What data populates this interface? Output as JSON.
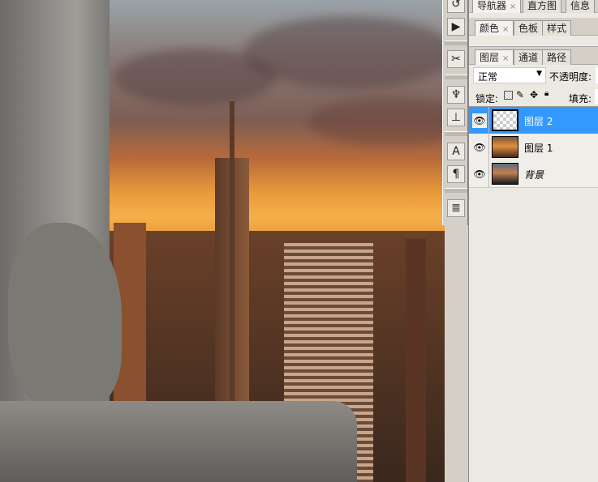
{
  "panels": {
    "top_tabs": [
      {
        "label": "导航器"
      },
      {
        "label": "直方图"
      },
      {
        "label": "信息"
      }
    ],
    "color_tabs": [
      {
        "label": "颜色"
      },
      {
        "label": "色板"
      },
      {
        "label": "样式"
      }
    ],
    "layer_tabs": [
      {
        "label": "图层"
      },
      {
        "label": "通道"
      },
      {
        "label": "路径"
      }
    ],
    "blend_mode": "正常",
    "opacity_label": "不透明度:",
    "lock_label": "锁定:",
    "fill_label": "填充:",
    "layers": [
      {
        "name": "图层 2",
        "selected": true
      },
      {
        "name": "图层 1",
        "selected": false
      },
      {
        "name": "背景",
        "selected": false
      }
    ]
  },
  "colors": {
    "selection": "#3399ff",
    "panel_bg": "#ece9e2"
  }
}
